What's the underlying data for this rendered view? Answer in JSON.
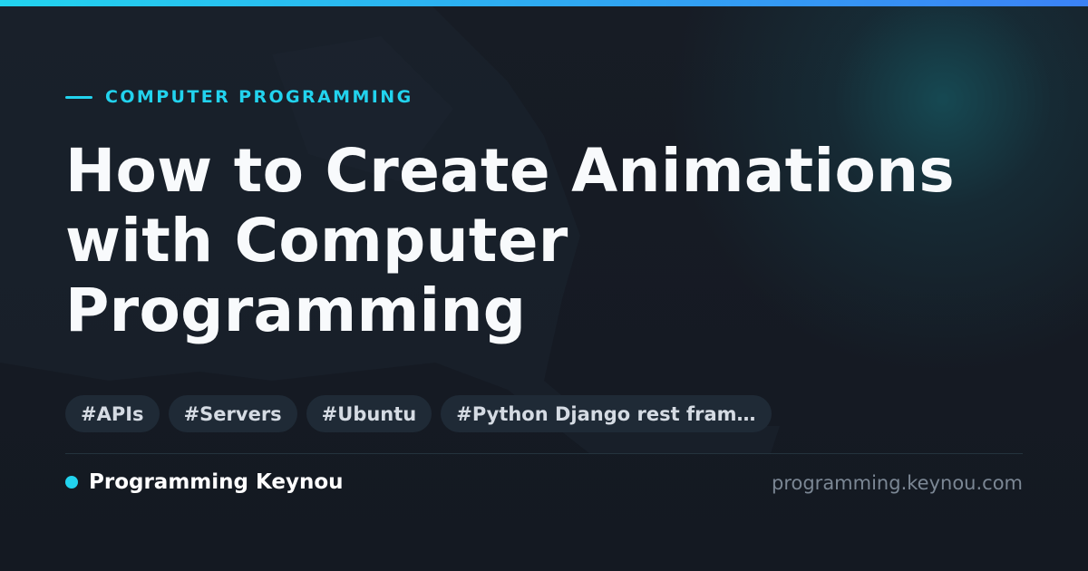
{
  "colors": {
    "accent": "#22d3ee",
    "accent_secondary": "#3b82f6",
    "background": "#161b24",
    "tag_background": "#1f2a36",
    "title_text": "#f8fafc",
    "muted_text": "#7b8794"
  },
  "header": {
    "category": "COMPUTER PROGRAMMING"
  },
  "article": {
    "title_lines": [
      "How to Create Animations",
      "with Computer",
      "Programming"
    ]
  },
  "tags": [
    "#APIs",
    "#Servers",
    "#Ubuntu",
    "#Python Django rest fram…"
  ],
  "footer": {
    "brand_name": "Programming Keynou",
    "domain": "programming.keynou.com",
    "brand_dot_icon": "dot-icon"
  }
}
